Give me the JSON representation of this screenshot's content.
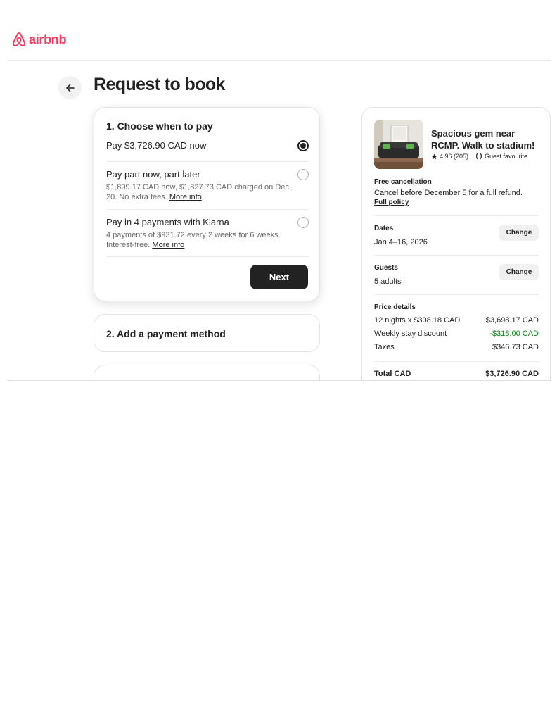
{
  "brand": {
    "logo_text": "airbnb",
    "color": "#ff385c",
    "icon": "airbnb-logo-icon"
  },
  "page": {
    "title": "Request to book",
    "back_icon": "arrow-left-icon"
  },
  "step1": {
    "title": "1. Choose when to pay",
    "options": [
      {
        "label": "Pay $3,726.90 CAD now",
        "selected": true
      },
      {
        "label": "Pay part now, part later",
        "description": "$1,899.17 CAD now, $1,827.73 CAD charged on Dec 20. No extra fees.",
        "link": "More info",
        "selected": false
      },
      {
        "label": "Pay in 4 payments with Klarna",
        "description": "4 payments of $931.72 every 2 weeks for 6 weeks. Interest-free.",
        "link": "More info",
        "selected": false
      }
    ],
    "next_label": "Next"
  },
  "step2": {
    "title": "2. Add a payment method"
  },
  "summary": {
    "listing_title": "Spacious gem near RCMP. Walk to stadium!",
    "rating": "4.96 (205)",
    "guest_favourite": "Guest favourite",
    "cancellation": {
      "label": "Free cancellation",
      "text": "Cancel before December 5 for a full refund.",
      "link": "Full policy"
    },
    "dates": {
      "label": "Dates",
      "value": "Jan 4–16, 2026",
      "change": "Change"
    },
    "guests": {
      "label": "Guests",
      "value": "5 adults",
      "change": "Change"
    },
    "price": {
      "label": "Price details",
      "rows": [
        {
          "label": "12 nights x $308.18 CAD",
          "value": "$3,698.17 CAD"
        },
        {
          "label": "Weekly stay discount",
          "value": "-$318.00 CAD",
          "color": "#008a05"
        },
        {
          "label": "Taxes",
          "value": "$346.73 CAD"
        }
      ],
      "total_label": "Total",
      "total_currency": "CAD",
      "total_value": "$3,726.90 CAD"
    }
  }
}
